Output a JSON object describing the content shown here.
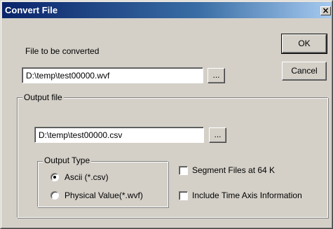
{
  "window": {
    "title": "Convert File",
    "close_glyph": "×"
  },
  "input_section": {
    "label": "File to be converted",
    "path": "D:\\temp\\test00000.wvf",
    "browse_label": "..."
  },
  "buttons": {
    "ok": "OK",
    "cancel": "Cancel"
  },
  "output_section": {
    "group_label": "Output file",
    "path": "D:\\temp\\test00000.csv",
    "browse_label": "..."
  },
  "output_type": {
    "group_label": "Output Type",
    "options": [
      {
        "label": "Ascii (*.csv)",
        "selected": true
      },
      {
        "label": "Physical Value(*.wvf)",
        "selected": false
      }
    ]
  },
  "options": {
    "segment": {
      "label": "Segment Files at 64 K",
      "checked": false
    },
    "time_axis": {
      "label": "Include Time Axis Information",
      "checked": false
    }
  },
  "colors": {
    "face": "#d4d0c8",
    "title_start": "#0a246a",
    "title_end": "#a6caf0"
  }
}
